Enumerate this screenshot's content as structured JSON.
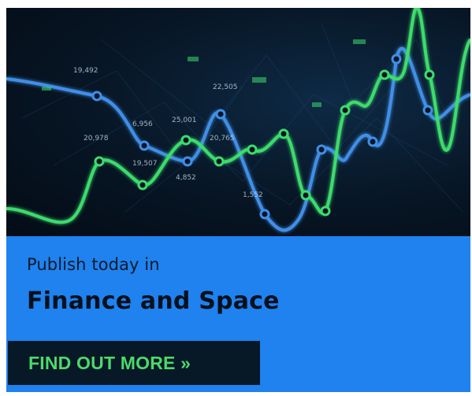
{
  "ad": {
    "subtitle": "Publish today in",
    "title": "Finance and Space",
    "cta_label": "FIND OUT MORE »"
  },
  "chart_overlay": {
    "labels": [
      "19,492",
      "6,956",
      "25,001",
      "22,505",
      "20,978",
      "19,507",
      "4,852",
      "20,765",
      "1,552"
    ],
    "colors": {
      "blue_series": "#3f8fe8",
      "green_series": "#3ddc6c",
      "panel_bg": "#1f82ee",
      "cta_bg": "#071827",
      "cta_text": "#4cd96a"
    }
  }
}
